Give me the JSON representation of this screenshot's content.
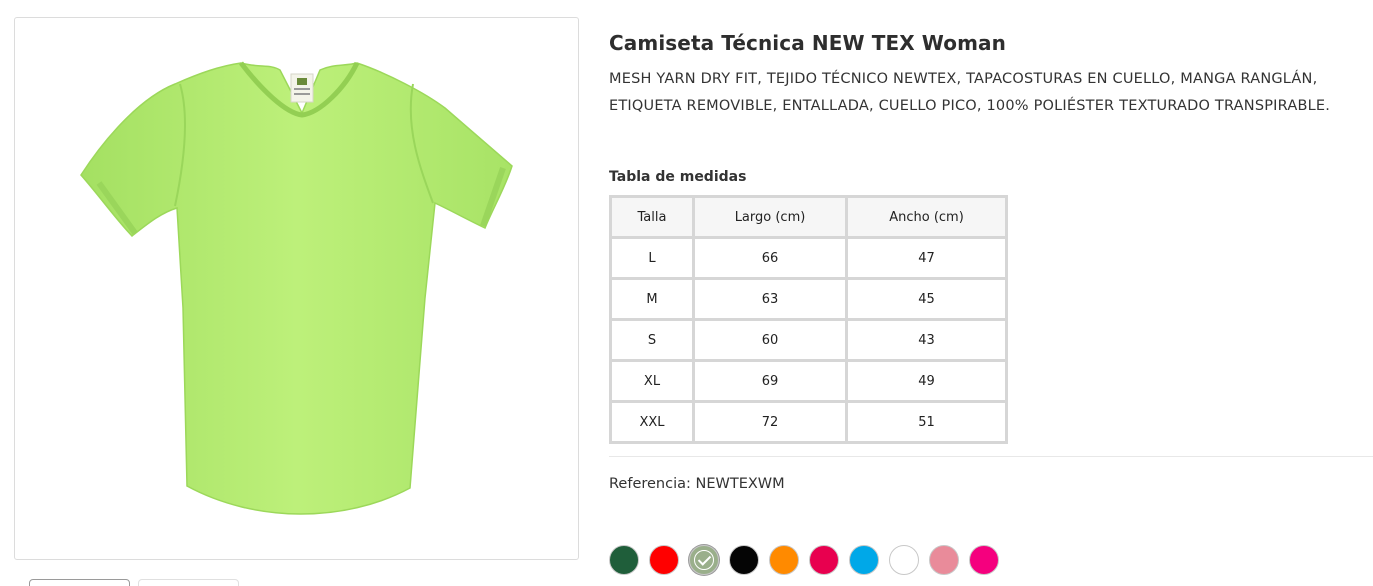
{
  "product": {
    "title": "Camiseta Técnica NEW TEX Woman",
    "description": "MESH YARN DRY FIT, TEJIDO TÉCNICO NEWTEX, TAPACOSTURAS EN CUELLO, MANGA RANGLÁN, ETIQUETA REMOVIBLE, ENTALLADA, CUELLO PICO, 100% POLIÉSTER TEXTURADO TRANSPIRABLE.",
    "image_color": "#b4ec6e",
    "reference_label": "Referencia: NEWTEXWM"
  },
  "size_table": {
    "heading": "Tabla de medidas",
    "headers": [
      "Talla",
      "Largo (cm)",
      "Ancho (cm)"
    ],
    "rows": [
      [
        "L",
        "66",
        "47"
      ],
      [
        "M",
        "63",
        "45"
      ],
      [
        "S",
        "60",
        "43"
      ],
      [
        "XL",
        "69",
        "49"
      ],
      [
        "XXL",
        "72",
        "51"
      ]
    ]
  },
  "colors": {
    "selected_index": 2,
    "swatches": [
      "#1f5e3a",
      "#ff0000",
      "#9aaf8b",
      "#050505",
      "#ff8a00",
      "#e8004f",
      "#00a8e8",
      "#ffffff",
      "#e98b9a",
      "#f5007e"
    ]
  }
}
